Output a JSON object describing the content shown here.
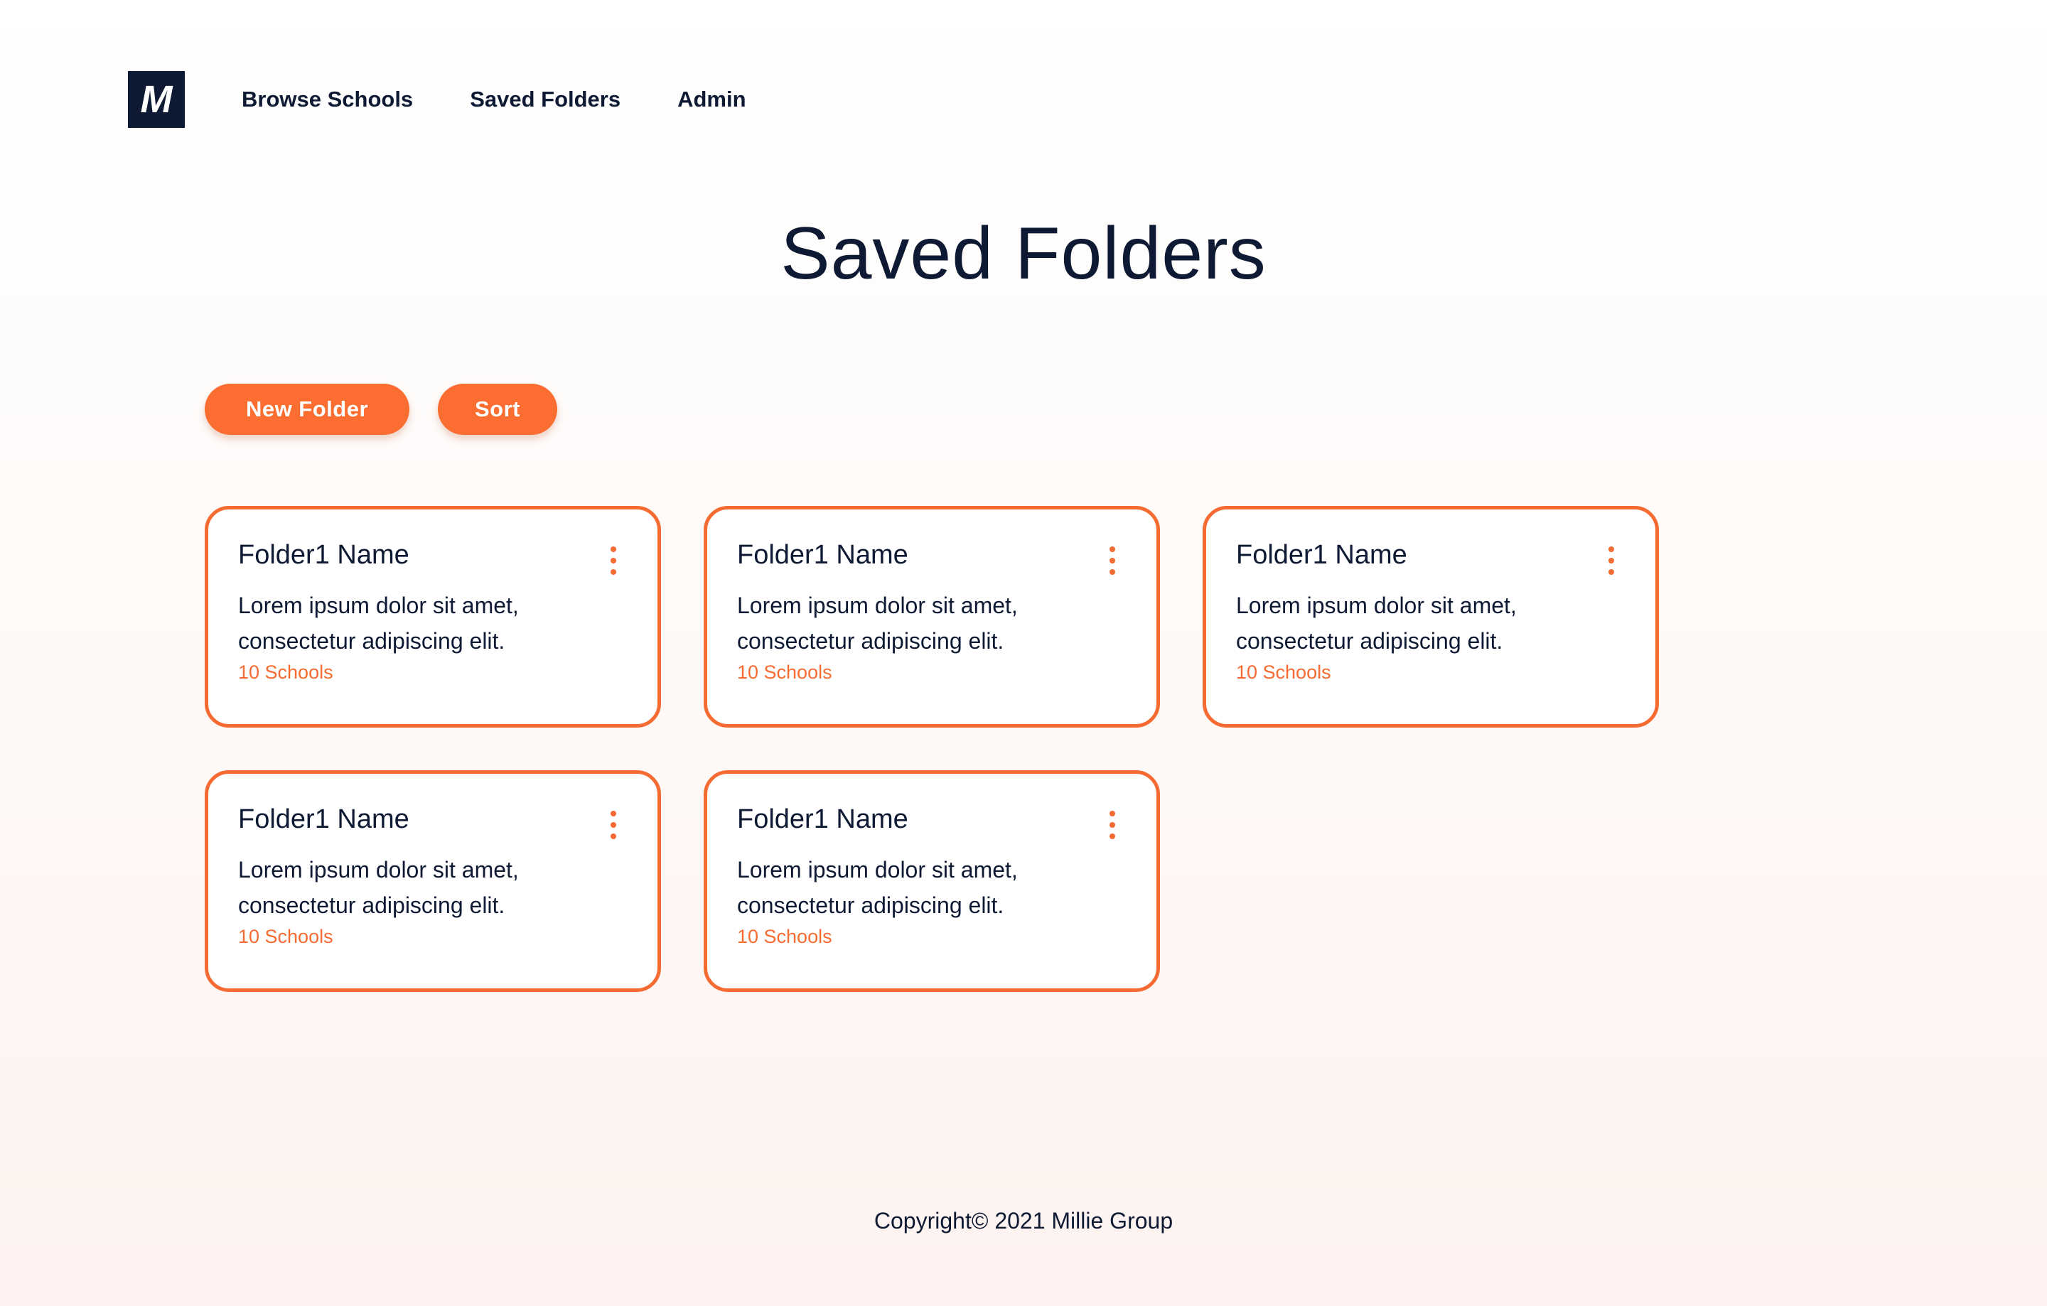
{
  "logo": {
    "letter": "M"
  },
  "nav": {
    "items": [
      {
        "label": "Browse Schools"
      },
      {
        "label": "Saved Folders"
      },
      {
        "label": "Admin"
      }
    ]
  },
  "page": {
    "title": "Saved Folders"
  },
  "actions": {
    "new_folder_label": "New Folder",
    "sort_label": "Sort"
  },
  "folders": [
    {
      "name": "Folder1 Name",
      "description": "Lorem ipsum dolor sit amet, consectetur adipiscing elit.",
      "count": "10 Schools"
    },
    {
      "name": "Folder1 Name",
      "description": "Lorem ipsum dolor sit amet, consectetur adipiscing elit.",
      "count": "10 Schools"
    },
    {
      "name": "Folder1 Name",
      "description": "Lorem ipsum dolor sit amet, consectetur adipiscing elit.",
      "count": "10 Schools"
    },
    {
      "name": "Folder1 Name",
      "description": "Lorem ipsum dolor sit amet, consectetur adipiscing elit.",
      "count": "10 Schools"
    },
    {
      "name": "Folder1 Name",
      "description": "Lorem ipsum dolor sit amet, consectetur adipiscing elit.",
      "count": "10 Schools"
    }
  ],
  "footer": {
    "copyright": "Copyright© 2021 Millie Group"
  },
  "colors": {
    "accent": "#f56b32",
    "button": "#fb6d30",
    "navy": "#0e1a33"
  },
  "icons": {
    "folder_menu": "kebab-menu-icon"
  }
}
